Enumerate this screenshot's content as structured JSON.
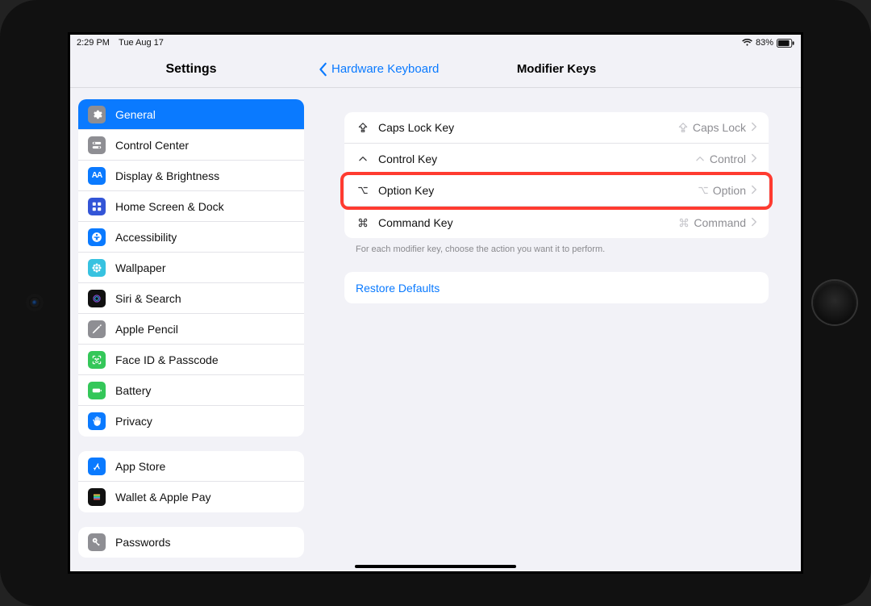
{
  "statusbar": {
    "time": "2:29 PM",
    "date": "Tue Aug 17",
    "battery_pct": "83%"
  },
  "sidebar": {
    "title": "Settings",
    "groups": [
      {
        "items": [
          {
            "label": "General",
            "icon": "gear",
            "bg": "#8e8e93",
            "selected": true
          },
          {
            "label": "Control Center",
            "icon": "switches",
            "bg": "#8e8e93"
          },
          {
            "label": "Display & Brightness",
            "icon": "AA",
            "bg": "#0a7aff"
          },
          {
            "label": "Home Screen & Dock",
            "icon": "grid",
            "bg": "#3355d7"
          },
          {
            "label": "Accessibility",
            "icon": "figure",
            "bg": "#0a7aff"
          },
          {
            "label": "Wallpaper",
            "icon": "flower",
            "bg": "#37c2e0"
          },
          {
            "label": "Siri & Search",
            "icon": "siri",
            "bg": "#111"
          },
          {
            "label": "Apple Pencil",
            "icon": "pencil",
            "bg": "#8e8e93"
          },
          {
            "label": "Face ID & Passcode",
            "icon": "faceid",
            "bg": "#34c759"
          },
          {
            "label": "Battery",
            "icon": "battery",
            "bg": "#34c759"
          },
          {
            "label": "Privacy",
            "icon": "hand",
            "bg": "#0a7aff"
          }
        ]
      },
      {
        "items": [
          {
            "label": "App Store",
            "icon": "appstore",
            "bg": "#0a7aff"
          },
          {
            "label": "Wallet & Apple Pay",
            "icon": "wallet",
            "bg": "#111"
          }
        ]
      },
      {
        "items": [
          {
            "label": "Passwords",
            "icon": "key",
            "bg": "#8e8e93"
          }
        ]
      }
    ]
  },
  "detail": {
    "back_label": "Hardware Keyboard",
    "title": "Modifier Keys",
    "rows": [
      {
        "icon": "capslock",
        "label": "Caps Lock Key",
        "value_icon": "capslock",
        "value": "Caps Lock"
      },
      {
        "icon": "control",
        "label": "Control Key",
        "value_icon": "control",
        "value": "Control"
      },
      {
        "icon": "option",
        "label": "Option Key",
        "value_icon": "option",
        "value": "Option",
        "highlight": true
      },
      {
        "icon": "command",
        "label": "Command Key",
        "value_icon": "command",
        "value": "Command"
      }
    ],
    "caption": "For each modifier key, choose the action you want it to perform.",
    "restore": "Restore Defaults"
  }
}
